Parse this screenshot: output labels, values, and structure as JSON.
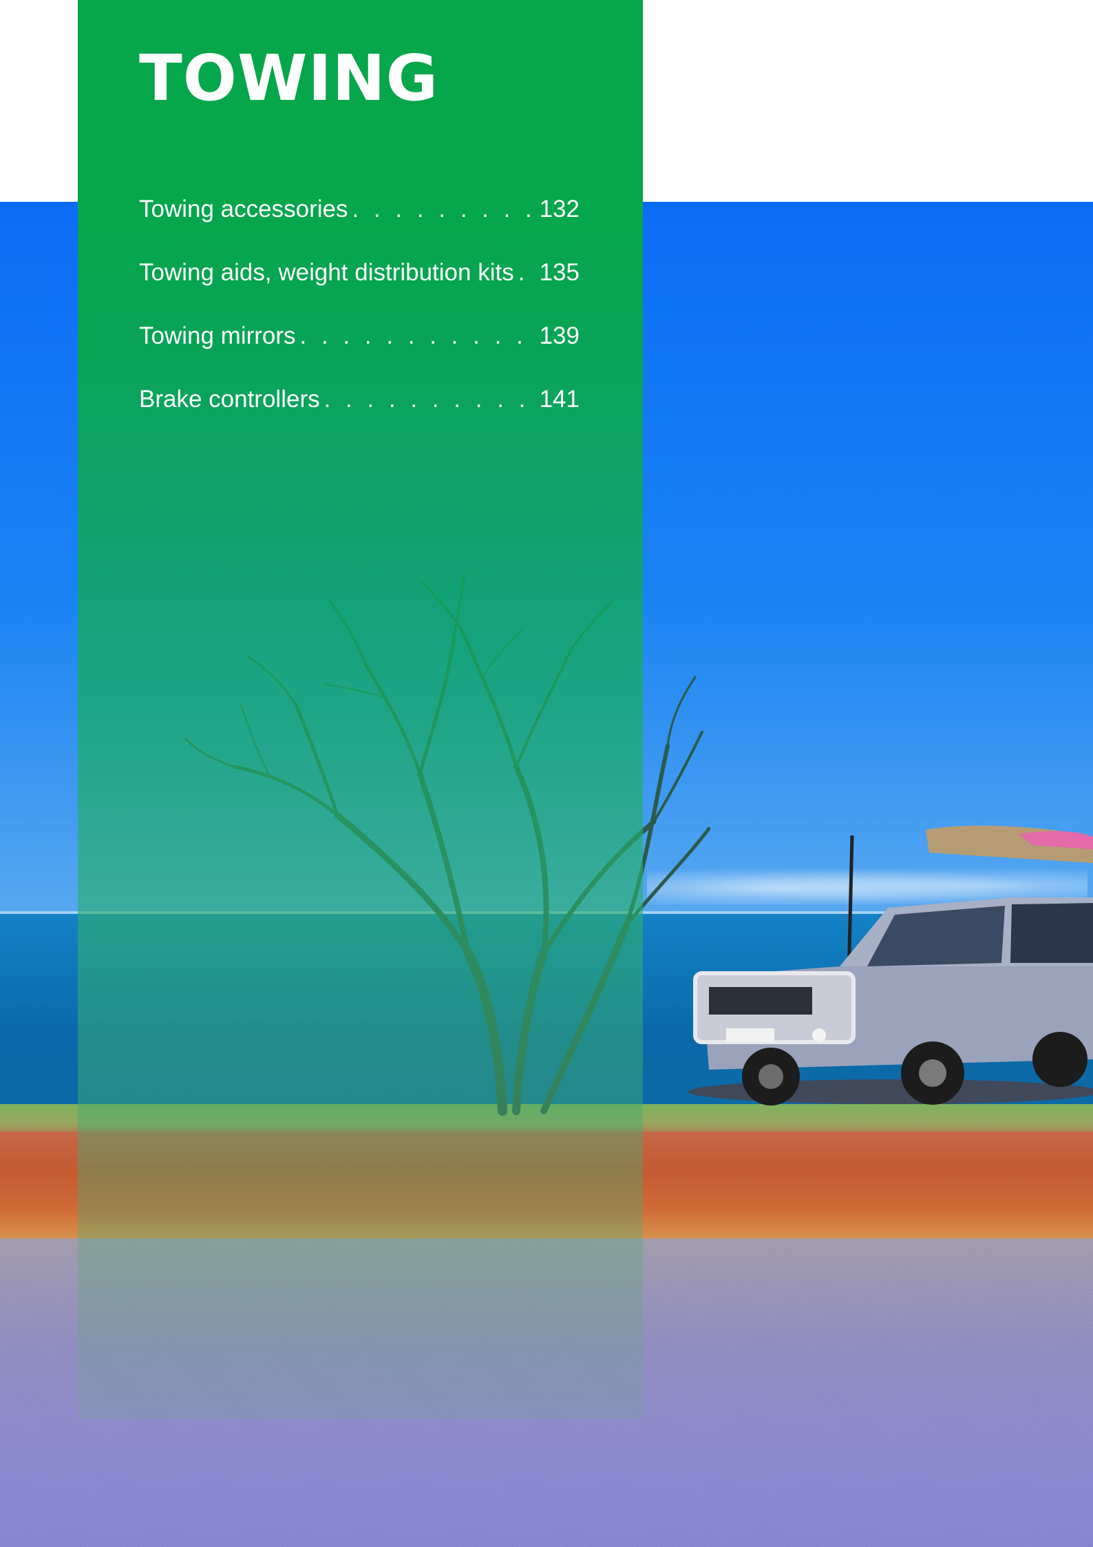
{
  "section": {
    "title": "TOWING",
    "accent_color": "#06a64b"
  },
  "toc": [
    {
      "label": "Towing accessories",
      "page": "132"
    },
    {
      "label": "Towing aids, weight distribution kits",
      "page": "135"
    },
    {
      "label": "Towing mirrors",
      "page": "139"
    },
    {
      "label": "Brake controllers",
      "page": "141"
    }
  ],
  "photo": {
    "description_icon": "tree-icon",
    "vehicle_icon": "car-icon"
  }
}
